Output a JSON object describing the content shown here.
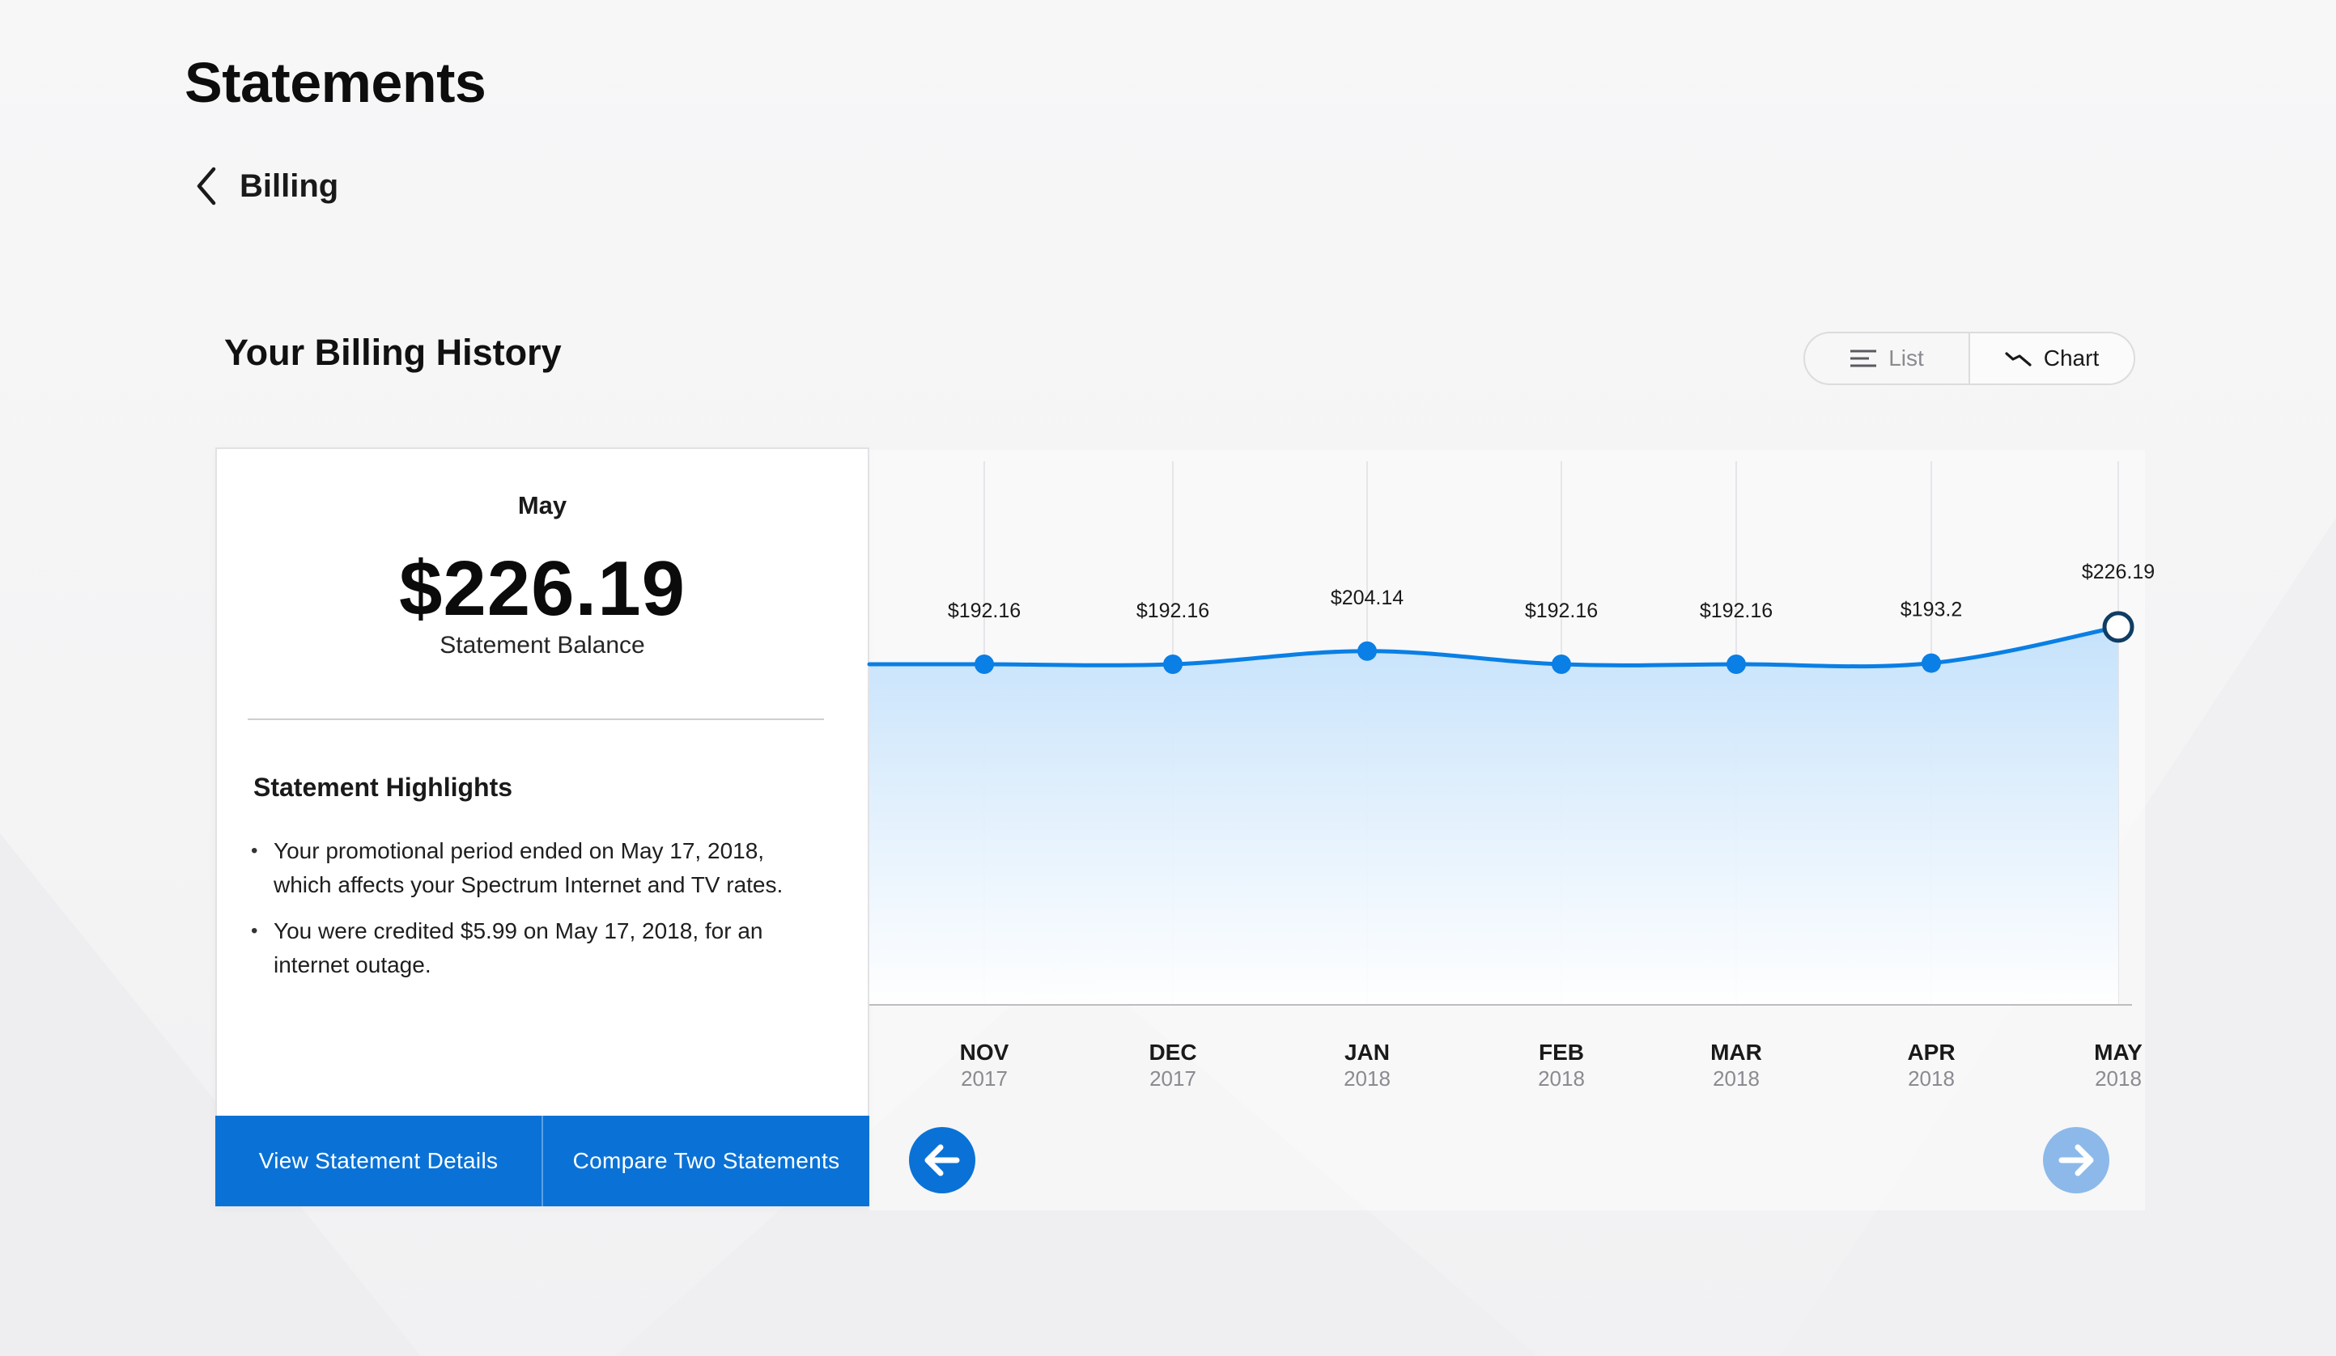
{
  "page": {
    "title": "Statements"
  },
  "breadcrumb": {
    "back_label": "Billing"
  },
  "section": {
    "title": "Your Billing History"
  },
  "view_toggle": {
    "list_label": "List",
    "chart_label": "Chart",
    "selected": "Chart"
  },
  "statement_card": {
    "month": "May",
    "amount": "$226.19",
    "amount_label": "Statement Balance",
    "highlights_title": "Statement Highlights",
    "highlights": [
      "Your promotional period ended on May 17, 2018, which affects your Spectrum Internet and TV rates.",
      "You were credited $5.99 on May 17, 2018, for an internet outage."
    ],
    "actions": {
      "view_details_label": "View Statement Details",
      "compare_label": "Compare Two Statements"
    }
  },
  "chart_data": {
    "type": "area",
    "categories": [
      "NOV",
      "DEC",
      "JAN",
      "FEB",
      "MAR",
      "APR",
      "MAY"
    ],
    "years": [
      "2017",
      "2017",
      "2018",
      "2018",
      "2018",
      "2018",
      "2018"
    ],
    "values": [
      192.16,
      192.16,
      204.14,
      192.16,
      192.16,
      193.2,
      226.19
    ],
    "value_labels": [
      "$192.16",
      "$192.16",
      "$204.14",
      "$192.16",
      "$192.16",
      "$193.2",
      "$226.19"
    ],
    "selected_index": 6,
    "grid": "vertical",
    "colors": {
      "line": "#0a7fe5",
      "point": "#0a7fe5",
      "selected_point_stroke": "#0f3d63",
      "fill_top": "#c5e2fb",
      "fill_bottom": "#ffffff"
    }
  },
  "chart_nav": {
    "prev_icon": "arrow-left-icon",
    "next_icon": "arrow-right-icon"
  },
  "colors": {
    "accent": "#0a72d6",
    "accent_disabled": "#8cb9ea"
  }
}
